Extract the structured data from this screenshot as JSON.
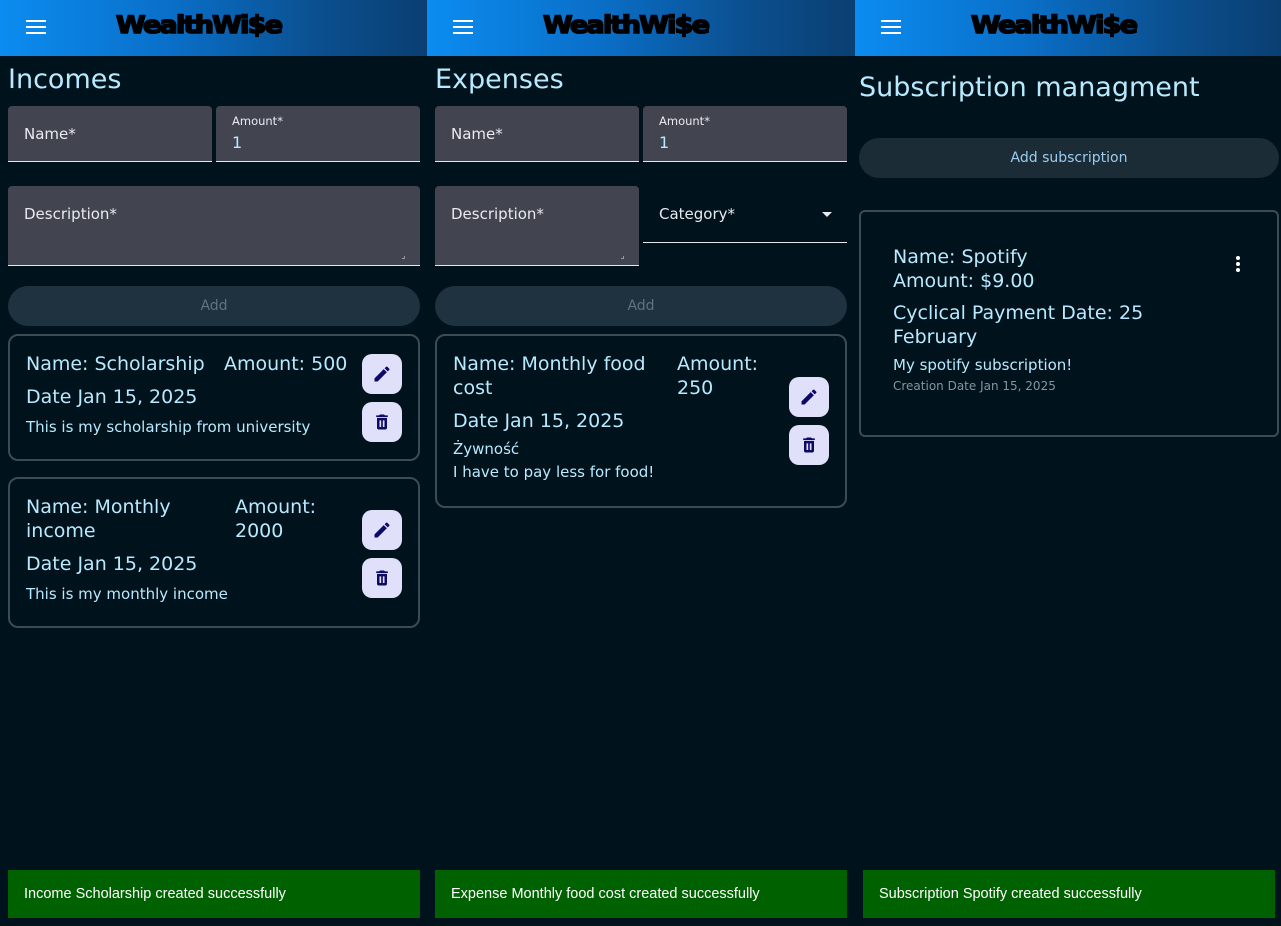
{
  "app": {
    "logo": "WealthWi$e"
  },
  "incomes": {
    "title": "Incomes",
    "name_label": "Name*",
    "amount_label": "Amount*",
    "amount_value": "1",
    "description_label": "Description*",
    "add_label": "Add",
    "items": [
      {
        "name": "Name: Scholarship",
        "amount": "Amount: 500",
        "date": "Date Jan 15, 2025",
        "description": "This is my scholarship from university"
      },
      {
        "name": "Name: Monthly income",
        "amount": "Amount: 2000",
        "date": "Date Jan 15, 2025",
        "description": "This is my monthly income"
      }
    ],
    "snackbar": "Income Scholarship created successfully"
  },
  "expenses": {
    "title": "Expenses",
    "name_label": "Name*",
    "amount_label": "Amount*",
    "amount_value": "1",
    "description_label": "Description*",
    "category_label": "Category*",
    "add_label": "Add",
    "items": [
      {
        "name": "Name: Monthly food cost",
        "amount": "Amount: 250",
        "date": "Date Jan 15, 2025",
        "category": "Żywność",
        "description": "I have to pay less for food!"
      }
    ],
    "snackbar": "Expense Monthly food cost created successfully"
  },
  "subscriptions": {
    "title": "Subscription managment",
    "add_label": "Add subscription",
    "items": [
      {
        "name": "Name: Spotify",
        "amount": "Amount: $9.00",
        "payment_date": "Cyclical Payment Date: 25 February",
        "description": "My spotify subscription!",
        "creation_date": "Creation Date Jan 15, 2025"
      }
    ],
    "snackbar": "Subscription Spotify created successfully"
  },
  "icons": [
    "menu-icon",
    "edit-icon",
    "delete-icon",
    "more-vert-icon",
    "dropdown-arrow-icon"
  ],
  "colors": {
    "background": "#00121b",
    "text": "#b7eaff",
    "snackbar": "#006100",
    "icon_button": "#e1e0fb"
  }
}
